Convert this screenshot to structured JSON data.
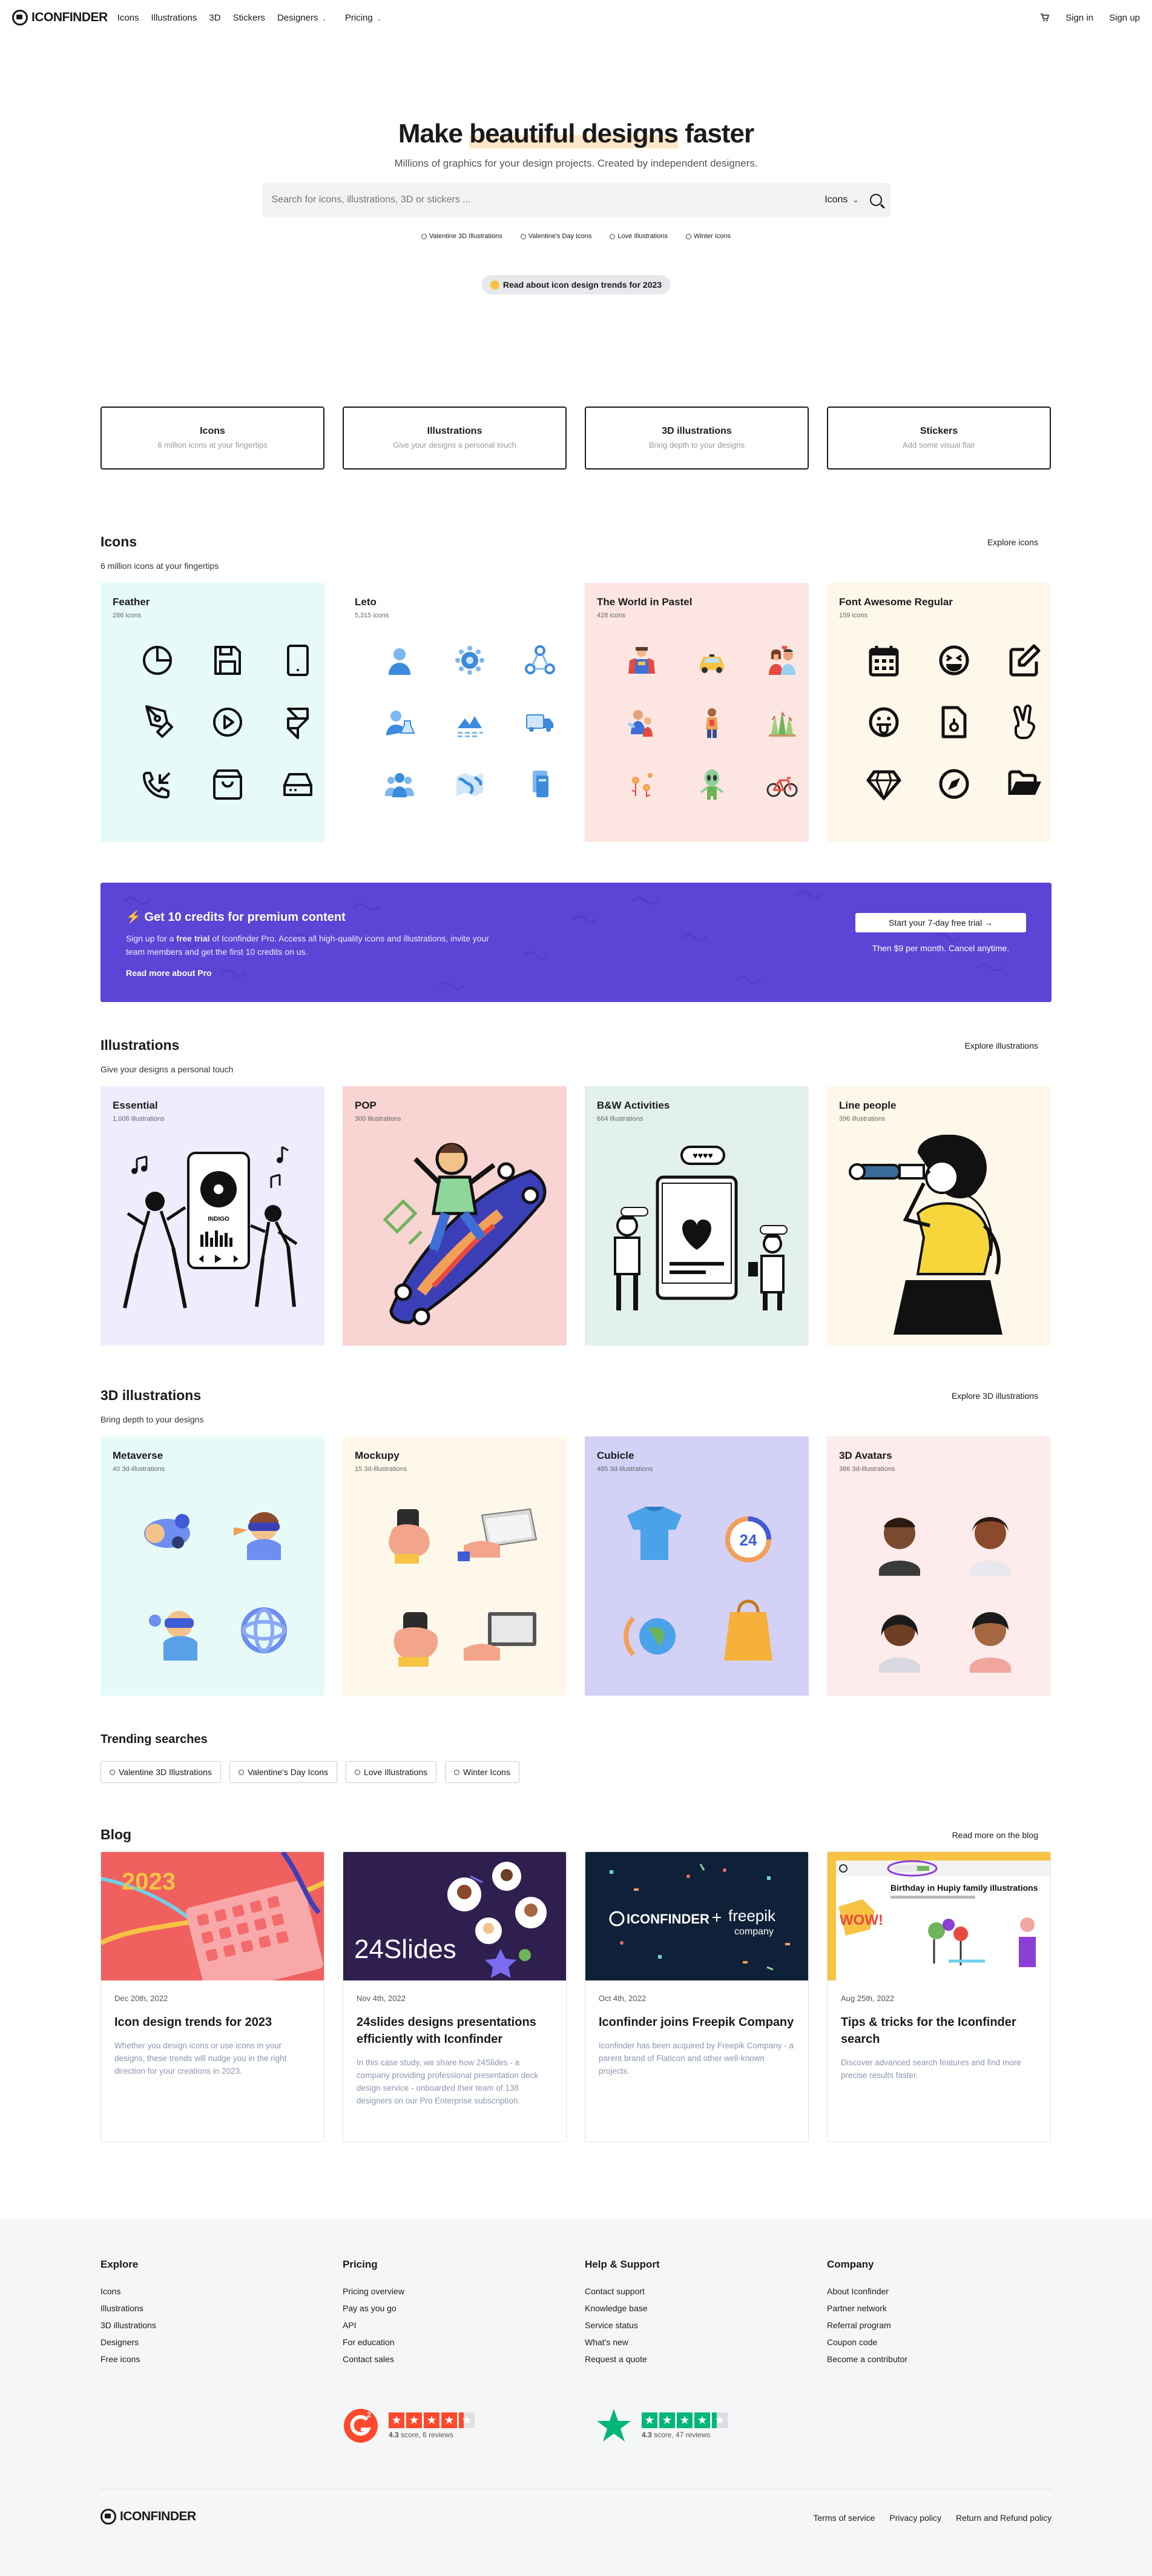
{
  "nav": {
    "logo": "ICONFINDER",
    "links": [
      "Icons",
      "Illustrations",
      "3D",
      "Stickers"
    ],
    "designers": "Designers",
    "pricing": "Pricing",
    "signin": "Sign in",
    "signup": "Sign up"
  },
  "hero": {
    "title_pre": "Make ",
    "title_hl": "beautiful designs",
    "title_post": " faster",
    "subtitle": "Millions of graphics for your design projects. Created by independent designers.",
    "search_placeholder": "Search for icons, illustrations, 3D or stickers ...",
    "search_type": "Icons",
    "tags": [
      "Valentine 3D Illustrations",
      "Valentine's Day Icons",
      "Love Illustrations",
      "Winter Icons"
    ],
    "trend_pill": "Read about icon design trends for 2023"
  },
  "categories": [
    {
      "title": "Icons",
      "desc": "6 million icons at your fingertips"
    },
    {
      "title": "Illustrations",
      "desc": "Give your designs a personal touch"
    },
    {
      "title": "3D illustrations",
      "desc": "Bring depth to your designs"
    },
    {
      "title": "Stickers",
      "desc": "Add some visual flair"
    }
  ],
  "icons_section": {
    "title": "Icons",
    "subtitle": "6 million icons at your fingertips",
    "explore": "Explore icons",
    "cards": [
      {
        "title": "Feather",
        "count": "286 icons",
        "bg": "#e6fbf8"
      },
      {
        "title": "Leto",
        "count": "5,315 icons",
        "bg": "#ffffff"
      },
      {
        "title": "The World in Pastel",
        "count": "428 icons",
        "bg": "#fde6e2"
      },
      {
        "title": "Font Awesome Regular",
        "count": "159 icons",
        "bg": "#fef8ea"
      }
    ]
  },
  "promo": {
    "title": "⚡ Get 10 credits for premium content",
    "desc_pre": "Sign up for a ",
    "desc_bold": "free trial",
    "desc_post": " of Iconfinder Pro. Access all high-quality icons and illustrations, invite your team members and get the first 10 credits on us.",
    "link": "Read more about Pro",
    "button": "Start your 7-day free trial →",
    "note": "Then $9 per month. Cancel anytime."
  },
  "illustrations_section": {
    "title": "Illustrations",
    "subtitle": "Give your designs a personal touch",
    "explore": "Explore illustrations",
    "cards": [
      {
        "title": "Essential",
        "count": "1,008 illustrations",
        "bg": "#efedfd"
      },
      {
        "title": "POP",
        "count": "300 illustrations",
        "bg": "#f8d4d2"
      },
      {
        "title": "B&W Activities",
        "count": "664 illustrations",
        "bg": "#e3f1ec"
      },
      {
        "title": "Line people",
        "count": "396 illustrations",
        "bg": "#fef8ea"
      }
    ],
    "phone_label": "INDIGO",
    "chat_hearts": "♥♥♥♥"
  },
  "threed_section": {
    "title": "3D illustrations",
    "subtitle": "Bring depth to your designs",
    "explore": "Explore 3D illustrations",
    "cards": [
      {
        "title": "Metaverse",
        "count": "40 3d-illustrations",
        "bg": "#e6fbf8"
      },
      {
        "title": "Mockupy",
        "count": "15 3d-illustrations",
        "bg": "#fef8ea"
      },
      {
        "title": "Cubicle",
        "count": "485 3d-illustrations",
        "bg": "#d4d1f7"
      },
      {
        "title": "3D Avatars",
        "count": "386 3d-illustrations",
        "bg": "#fdeceb"
      }
    ],
    "badge_24": "24"
  },
  "trending": {
    "title": "Trending searches",
    "items": [
      "Valentine 3D Illustrations",
      "Valentine's Day Icons",
      "Love Illustrations",
      "Winter Icons"
    ]
  },
  "blog": {
    "title": "Blog",
    "explore": "Read more on the blog",
    "img_labels": {
      "year": "2023",
      "slides": "24Slides",
      "iconfinder": "ICONFINDER",
      "freepik": "freepik",
      "freepik_sub": "company",
      "wow": "WOW!",
      "tips_header": "Birthday in Hupiy family illustrations"
    },
    "posts": [
      {
        "date": "Dec 20th, 2022",
        "title": "Icon design trends for 2023",
        "excerpt": "Whether you design icons or use icons in your designs, these trends will nudge you in the right direction for your creations in 2023."
      },
      {
        "date": "Nov 4th, 2022",
        "title": "24slides designs presentations efficiently with Iconfinder",
        "excerpt": "In this case study, we share how 24Slides - a company providing professional presentation deck design service - onboarded their team of 138 designers on our Pro Enterprise subscription."
      },
      {
        "date": "Oct 4th, 2022",
        "title": "Iconfinder joins Freepik Company",
        "excerpt": "Iconfinder has been acquired by Freepik Company - a parent brand of Flaticon and other well-known projects."
      },
      {
        "date": "Aug 25th, 2022",
        "title": "Tips & tricks for the Iconfinder search",
        "excerpt": "Discover advanced search features and find more precise results faster."
      }
    ]
  },
  "footer": {
    "columns": [
      {
        "title": "Explore",
        "links": [
          "Icons",
          "Illustrations",
          "3D illustrations",
          "Designers",
          "Free icons"
        ]
      },
      {
        "title": "Pricing",
        "links": [
          "Pricing overview",
          "Pay as you go",
          "API",
          "For education",
          "Contact sales"
        ]
      },
      {
        "title": "Help & Support",
        "links": [
          "Contact support",
          "Knowledge base",
          "Service status",
          "What's new",
          "Request a quote"
        ]
      },
      {
        "title": "Company",
        "links": [
          "About Iconfinder",
          "Partner network",
          "Referral program",
          "Coupon code",
          "Become a contributor"
        ]
      }
    ],
    "g2": {
      "score": "4.3",
      "text": "score, 6 reviews",
      "color": "#ff492c"
    },
    "trustpilot": {
      "score": "4.3",
      "text": "score, 47 reviews",
      "color": "#00b67a"
    },
    "logo": "ICONFINDER",
    "bottom_links": [
      "Terms of service",
      "Privacy policy",
      "Return and Refund policy"
    ]
  }
}
